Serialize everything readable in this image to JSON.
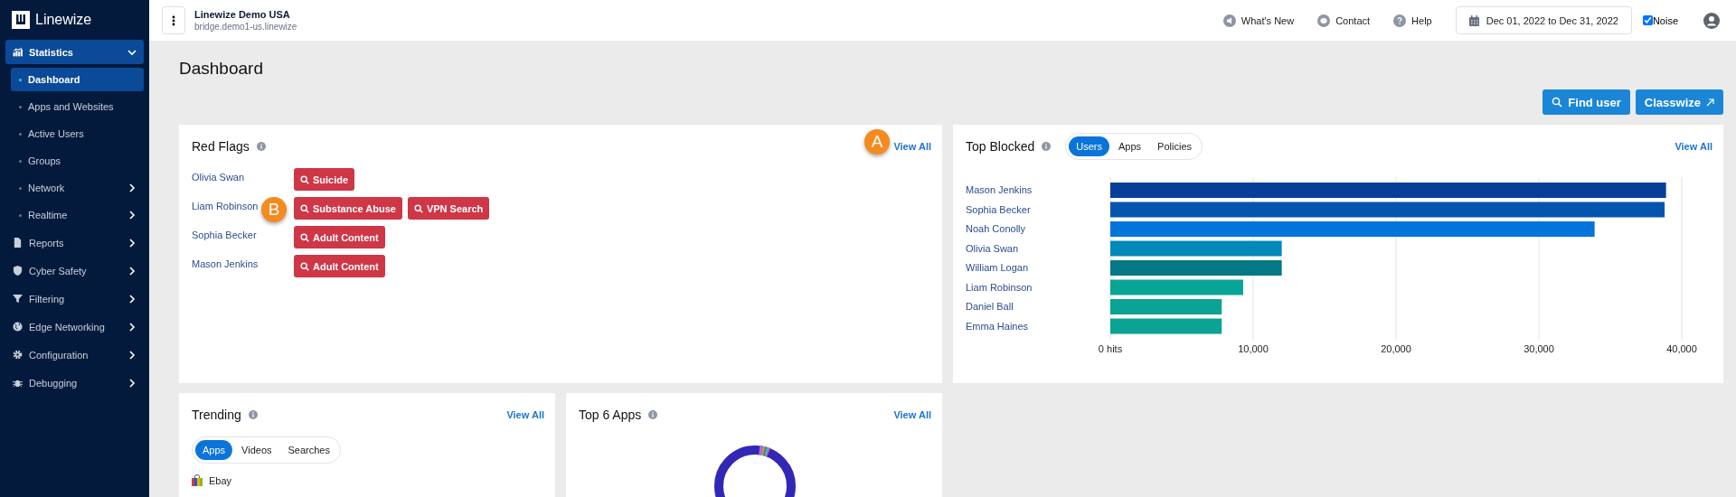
{
  "sidebar": {
    "logo": "Linewize",
    "items": [
      {
        "label": "Statistics",
        "kind": "group",
        "expanded": true,
        "children": [
          {
            "label": "Dashboard",
            "kind": "link",
            "selected": true
          },
          {
            "label": "Apps and Websites",
            "kind": "link",
            "selected": false
          },
          {
            "label": "Active Users",
            "kind": "link",
            "selected": false
          },
          {
            "label": "Groups",
            "kind": "link",
            "selected": false
          },
          {
            "label": "Network",
            "kind": "group",
            "expanded": false,
            "selected": false
          },
          {
            "label": "Realtime",
            "kind": "group",
            "expanded": false,
            "selected": false
          }
        ]
      },
      {
        "label": "Reports",
        "kind": "group",
        "expanded": false
      },
      {
        "label": "Cyber Safety",
        "kind": "group",
        "expanded": false
      },
      {
        "label": "Filtering",
        "kind": "group",
        "expanded": false
      },
      {
        "label": "Edge Networking",
        "kind": "group",
        "expanded": false
      },
      {
        "label": "Configuration",
        "kind": "group",
        "expanded": false
      },
      {
        "label": "Debugging",
        "kind": "group",
        "expanded": false
      }
    ]
  },
  "top_bar": {
    "org_name": "Linewize Demo USA",
    "host": "bridge.demo1-us.linewize",
    "links": [
      "What's New",
      "Contact",
      "Help"
    ],
    "date_range": "Dec 01, 2022 to Dec 31, 2022",
    "noise": {
      "label": "Noise",
      "checked": true
    }
  },
  "page": {
    "title": "Dashboard",
    "buttons": [
      "Find user",
      "Classwize"
    ]
  },
  "red_flags": {
    "title": "Red Flags",
    "view_all": "View All",
    "markers": [
      "A",
      "B"
    ],
    "rows": [
      {
        "name": "Olivia Swan",
        "flags": [
          "Suicide"
        ]
      },
      {
        "name": "Liam Robinson",
        "flags": [
          "Substance Abuse",
          "VPN Search"
        ]
      },
      {
        "name": "Sophia Becker",
        "flags": [
          "Adult Content"
        ]
      },
      {
        "name": "Mason Jenkins",
        "flags": [
          "Adult Content"
        ]
      }
    ]
  },
  "top_blocked": {
    "title": "Top Blocked",
    "view_all": "View All",
    "tabs": [
      {
        "label": "Users",
        "selected": true
      },
      {
        "label": "Apps",
        "selected": false
      },
      {
        "label": "Policies",
        "selected": false
      }
    ],
    "chart_data": {
      "type": "bar",
      "orientation": "horizontal",
      "categories": [
        "Mason Jenkins",
        "Sophia Becker",
        "Noah Conolly",
        "Olivia Swan",
        "William Logan",
        "Liam Robinson",
        "Daniel Ball",
        "Emma Haines"
      ],
      "values": [
        38900,
        38800,
        33900,
        12000,
        12000,
        9300,
        7800,
        7800
      ],
      "colors": [
        "#053f97",
        "#0355ae",
        "#0275dc",
        "#0189b9",
        "#047985",
        "#08a596",
        "#0aa394",
        "#0aa394"
      ],
      "xlim": [
        0,
        40000
      ],
      "grid": true,
      "xticks": [
        {
          "value": 0,
          "label": "0 hits"
        },
        {
          "value": 10000,
          "label": "10,000"
        },
        {
          "value": 20000,
          "label": "20,000"
        },
        {
          "value": 30000,
          "label": "30,000"
        },
        {
          "value": 40000,
          "label": "40,000"
        }
      ]
    }
  },
  "trending": {
    "title": "Trending",
    "view_all": "View All",
    "tabs": [
      {
        "label": "Apps",
        "selected": true
      },
      {
        "label": "Videos",
        "selected": false
      },
      {
        "label": "Searches",
        "selected": false
      }
    ],
    "items": [
      "Ebay"
    ]
  },
  "top_apps": {
    "title": "Top 6 Apps",
    "view_all": "View All"
  }
}
